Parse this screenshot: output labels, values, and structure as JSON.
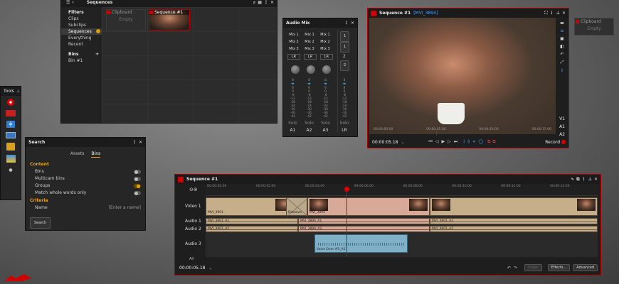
{
  "sequences_panel": {
    "title": "Sequences",
    "filters_heading": "Filters",
    "filters": [
      "Clips",
      "Subclips",
      "Sequences",
      "Everything",
      "Recent"
    ],
    "bins_heading": "Bins",
    "bins": [
      "Bin #1"
    ],
    "clipboard_label": "Clipboard",
    "clipboard_empty": "Empty",
    "sequence_thumb": "Sequence #1"
  },
  "audio_mix": {
    "title": "Audio Mix",
    "mix_buttons": [
      [
        "Mix 1",
        "Mix 1",
        "Mix 1"
      ],
      [
        "Mix 2",
        "Mix 2",
        "Mix 2"
      ],
      [
        "Mix 3",
        "Mix 3",
        "Mix 3"
      ]
    ],
    "lr_labels": [
      "LR",
      "LR",
      "LR"
    ],
    "side_buttons": [
      "1",
      "1",
      "2",
      "2"
    ],
    "solo_labels": [
      "Solo",
      "Solo",
      "Solo",
      "Solo"
    ],
    "channel_labels": [
      "A1",
      "A2",
      "A3",
      "LR"
    ],
    "meter_ticks": [
      "6",
      "0",
      "-6",
      "-12",
      "-18",
      "-24",
      "-30",
      "-36",
      "-42"
    ]
  },
  "viewer": {
    "title": "Sequence #1",
    "clip_name": "[MVI_3894]",
    "ruler": [
      "00:00:00.00",
      "00:00:05.00",
      "00:00:10.00",
      "00:00:15.00"
    ],
    "timecode": "00:00:05.18",
    "tracks": [
      "V1",
      "A1",
      "A2"
    ],
    "record_label": "Record"
  },
  "clipboard_floating": {
    "title": "Clipboard",
    "empty": "Empty"
  },
  "tools": {
    "title": "Tools"
  },
  "search": {
    "title": "Search",
    "tabs": [
      "Assets",
      "Bins"
    ],
    "content_heading": "Content",
    "options": [
      "Bins",
      "Multicam bins",
      "Groups",
      "Match whole words only"
    ],
    "criteria_heading": "Criteria",
    "name_label": "Name",
    "name_placeholder": "[Enter a name]",
    "search_button": "Search"
  },
  "timeline": {
    "title": "Sequence #1",
    "ruler": [
      "00:00:00.00",
      "00:00:02.00",
      "00:00:04.00",
      "00:00:06.00",
      "00:00:08.00",
      "00:00:10.00",
      "00:00:12.00",
      "00:00:14.00"
    ],
    "track_labels": [
      "Video 1",
      "Audio 1",
      "Audio 2",
      "Audio 3"
    ],
    "all_label": "All",
    "timecode": "00:00:05.18",
    "video_clips": [
      "MVI_3901",
      "Dissolve",
      "MVI_3894",
      ""
    ],
    "audio1_clips": [
      "MVI_3901_A1",
      "MVI_3894_A1",
      "MVI_3901_A1"
    ],
    "audio2_clips": [
      "MVI_3901_A2",
      "MVI_3894_A2",
      "MVI_3901_A2"
    ],
    "audio3_clip": "Voice Over #5_A1",
    "buttons": [
      "Unpin",
      "Effects...",
      "Advanced"
    ],
    "playhead_fraction": 0.36
  }
}
